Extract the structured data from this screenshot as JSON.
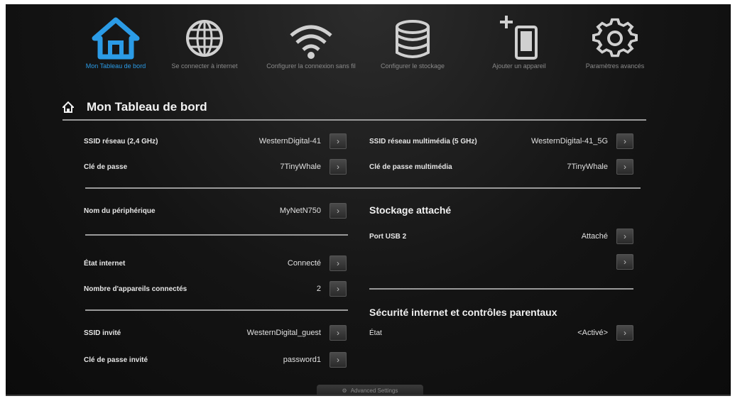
{
  "nav": {
    "items": [
      {
        "label": "Mon Tableau de bord",
        "icon": "home-icon"
      },
      {
        "label": "Se connecter à internet",
        "icon": "globe-icon"
      },
      {
        "label": "Configurer la connexion sans fil",
        "icon": "wifi-icon"
      },
      {
        "label": "Configurer le stockage",
        "icon": "storage-icon"
      },
      {
        "label": "Ajouter un appareil",
        "icon": "add-device-icon"
      },
      {
        "label": "Paramètres avancés",
        "icon": "gear-icon"
      }
    ]
  },
  "header": {
    "title": "Mon Tableau de bord",
    "icon": "home-icon"
  },
  "left": {
    "ssid": {
      "label": "SSID réseau (2,4 GHz)",
      "value": "WesternDigital-41"
    },
    "passkey": {
      "label": "Clé de passe",
      "value": "7TinyWhale"
    },
    "device_name": {
      "label": "Nom du périphérique",
      "value": "MyNetN750"
    },
    "internet_state": {
      "label": "État internet",
      "value": "Connecté"
    },
    "connected_devices": {
      "label": "Nombre d'appareils connectés",
      "value": "2"
    },
    "guest_ssid": {
      "label": "SSID invité",
      "value": "WesternDigital_guest"
    },
    "guest_passkey": {
      "label": "Clé de passe invité",
      "value": "password1"
    }
  },
  "right": {
    "media_ssid": {
      "label": "SSID réseau multimédia (5 GHz)",
      "value": "WesternDigital-41_5G"
    },
    "media_passkey": {
      "label": "Clé de passe multimédia",
      "value": "7TinyWhale"
    },
    "storage": {
      "title": "Stockage attaché",
      "usb_label": "Port USB 2",
      "usb_value": "Attaché"
    },
    "security": {
      "title": "Sécurité internet et contrôles parentaux",
      "state_label": "État",
      "state_value": "<Activé>"
    }
  },
  "footer": {
    "advanced_tab": "Advanced Settings"
  },
  "colors": {
    "accent": "#2b9be6",
    "background": "#141414"
  }
}
